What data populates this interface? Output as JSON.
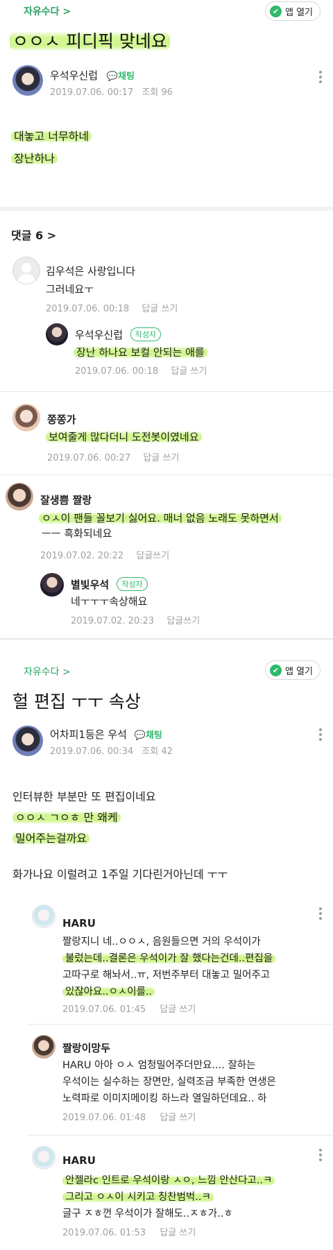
{
  "post1": {
    "cafe_label": "자유수다 >",
    "app_open": "앱 열기",
    "title": "ㅇㅇㅅ 피디픽 맞네요",
    "author": "우석우신럽",
    "chat_label": "채팅",
    "date": "2019.07.06. 00:17",
    "views": "조회 96",
    "body_lines": [
      "대놓고 너무하네",
      "장난하나"
    ],
    "comments_header": "댓글 6 >"
  },
  "comments": [
    {
      "author": "김우석은 사랑입니다",
      "text": "그러네요ㅜ",
      "date": "2019.07.06. 00:18",
      "reply": "답글 쓰기"
    },
    {
      "author": "우석우신럽",
      "writer_badge": "작성자",
      "text": "장난 하나요 보컬 안되는 애를",
      "date": "2019.07.06. 00:18",
      "reply": "답글 쓰기"
    },
    {
      "author": "쫑쫑가",
      "text": "보여줄게 많다더니 도전봇이였네요",
      "date": "2019.07.06. 00:27",
      "reply": "답글 쓰기"
    },
    {
      "author": "잘생쁨 짤랑",
      "text_line1": "ㅇㅅ이 팬들 꼴보기 싫어요. 매너 없음 노래도 못하면서",
      "text_line2": "ㅡㅡ 흑화되네요",
      "date": "2019.07.02. 20:22",
      "reply": "답글쓰기"
    },
    {
      "author": "별빛우석",
      "writer_badge": "작성자",
      "text": "네ㅜㅜㅜ속상해요",
      "date": "2019.07.02. 20:23",
      "reply": "답글쓰기"
    }
  ],
  "post2": {
    "cafe_label": "자유수다 >",
    "app_open": "앱 열기",
    "title": "헐 편집 ㅜㅜ 속상",
    "author": "어차피1등은 우석",
    "chat_label": "채팅",
    "date": "2019.07.06. 00:34",
    "views": "조회 42",
    "body_lines": [
      "인터뷰한 부분만 또 편집이네요",
      "ㅇㅇㅅ ㄱㅇㅎ 만 왜케",
      "밀어주는걸까요",
      "",
      "화가나요 이럴려고 1주일 기다린거아닌데 ㅜㅜ"
    ]
  },
  "comments2": [
    {
      "author": "HARU",
      "lines": [
        "짤랑지니 네..ㅇㅇㅅ, 음원들으면 거의 우석이가",
        "불렀는데..결론은 우석이가 잘 했다는건데..편집을",
        "고따구로 해놔서..ㅠ, 저번주부터 대놓고 밀어주고",
        "있잖아요..ㅇㅅ이를.."
      ],
      "date": "2019.07.06. 01:45",
      "reply": "답글 쓰기"
    },
    {
      "author": "짤랑이망두",
      "lines": [
        "HARU 아아 ㅇㅅ 엄청밀어주더만요.... 잘하는",
        "우석이는 실수하는 장면만, 실력조금 부족한 연생은",
        "노력파로 이미지메이킹 하느라 열일하던데요.. 하"
      ],
      "date": "2019.07.06. 01:48",
      "reply": "답글 쓰기"
    },
    {
      "author": "HARU",
      "lines": [
        "안젤라c 인트로 우석이랑 ㅅㅇ, 느낌 안산다고..ㅋ",
        "그리고 ㅇㅅ이 시키고 칭찬범벅..ㅋ",
        "글구 ㅈㅎ껀 우석이가 잘해도..ㅈㅎ가..ㅎ"
      ],
      "date": "2019.07.06. 01:53",
      "reply": "답글 쓰기"
    }
  ]
}
